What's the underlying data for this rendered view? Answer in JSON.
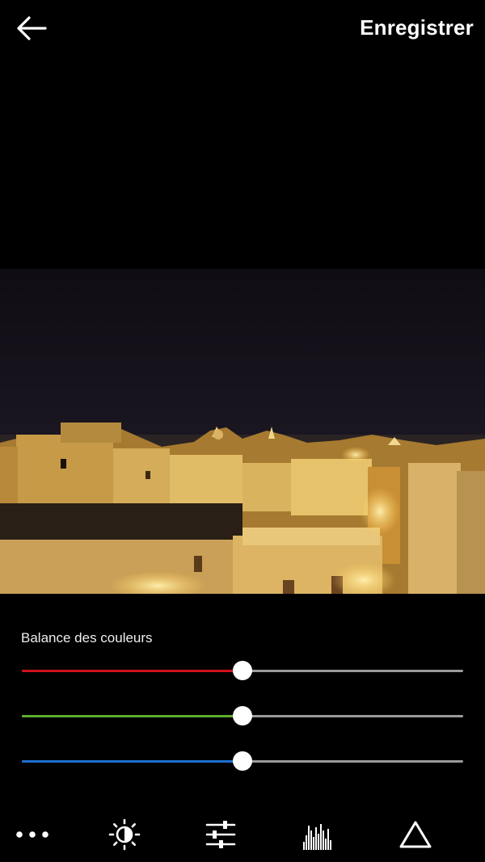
{
  "header": {
    "back_icon": "arrow-left-icon",
    "save_label": "Enregistrer"
  },
  "photo": {
    "subject": "night city skyline photo"
  },
  "color_balance": {
    "title": "Balance des couleurs",
    "sliders": [
      {
        "channel": "red",
        "color": "#d0121b",
        "value": 0.5
      },
      {
        "channel": "green",
        "color": "#5fae2e",
        "value": 0.5
      },
      {
        "channel": "blue",
        "color": "#1f6fd1",
        "value": 0.5
      }
    ]
  },
  "toolbar": {
    "tools": [
      {
        "icon": "more-dots-icon"
      },
      {
        "icon": "brightness-icon"
      },
      {
        "icon": "sliders-icon"
      },
      {
        "icon": "histogram-icon"
      },
      {
        "icon": "triangle-icon"
      }
    ]
  }
}
